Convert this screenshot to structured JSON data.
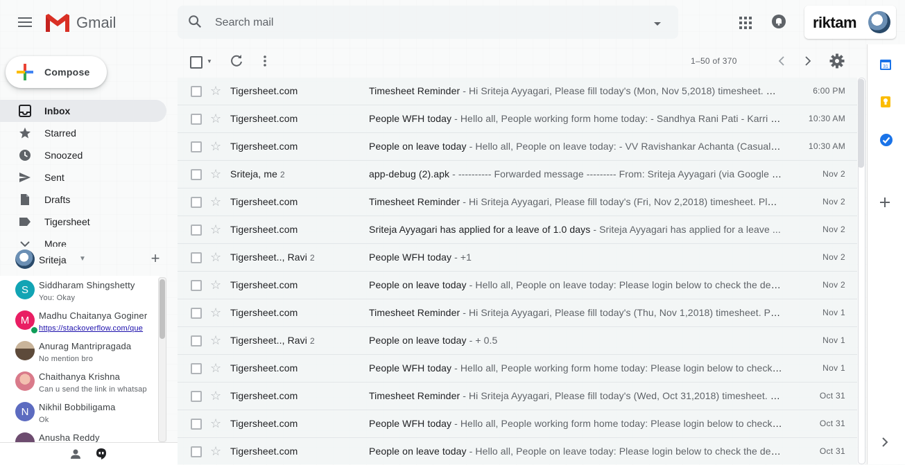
{
  "header": {
    "logo_text": "Gmail",
    "search_placeholder": "Search mail",
    "org_name": "riktam"
  },
  "sidebar": {
    "compose_label": "Compose",
    "items": [
      {
        "label": "Inbox",
        "icon": "inbox-icon",
        "active": true
      },
      {
        "label": "Starred",
        "icon": "star-icon"
      },
      {
        "label": "Snoozed",
        "icon": "clock-icon"
      },
      {
        "label": "Sent",
        "icon": "send-icon"
      },
      {
        "label": "Drafts",
        "icon": "draft-icon"
      },
      {
        "label": "Tigersheet",
        "icon": "label-icon"
      },
      {
        "label": "More",
        "icon": "chevron-down-icon"
      }
    ]
  },
  "hangouts": {
    "user_name": "Sriteja",
    "contacts": [
      {
        "name": "Siddharam Shingshetty",
        "message": "You: Okay",
        "initial": "S",
        "color": "#12a4b4",
        "link": false,
        "online": false
      },
      {
        "name": "Madhu Chaitanya Goginer",
        "message": "https://stackoverflow.com/que",
        "initial": "M",
        "color": "#e91e63",
        "link": true,
        "online": true
      },
      {
        "name": "Anurag Mantripragada",
        "message": "No mention bro",
        "initial": "",
        "color": "#5d4a3a",
        "link": false,
        "online": false
      },
      {
        "name": "Chaithanya Krishna",
        "message": "Can u send the link in whatsap",
        "initial": "",
        "color": "#d97a8a",
        "link": false,
        "online": false
      },
      {
        "name": "Nikhil Bobbiligama",
        "message": "Ok",
        "initial": "N",
        "color": "#5c6bc0",
        "link": false,
        "online": false
      },
      {
        "name": "Anusha Reddy",
        "message": "",
        "initial": "",
        "color": "#6d4c6f",
        "link": false,
        "online": false
      }
    ]
  },
  "toolbar": {
    "pagination": "1–50 of 370"
  },
  "emails": [
    {
      "sender": "Tigersheet.com",
      "count": "",
      "subject": "Timesheet Reminder",
      "snippet": " - Hi Sriteja Ayyagari, Please fill today's (Mon, Nov 5,2018) timesheet. Pl...",
      "date": "6:00 PM"
    },
    {
      "sender": "Tigersheet.com",
      "count": "",
      "subject": "People WFH today",
      "snippet": " - Hello all, People working form home today: - Sandhya Rani Pati - Karri S...",
      "date": "10:30 AM"
    },
    {
      "sender": "Tigersheet.com",
      "count": "",
      "subject": "People on leave today",
      "snippet": " - Hello all, People on leave today: - VV Ravishankar Achanta (Casual) -...",
      "date": "10:30 AM"
    },
    {
      "sender": "Sriteja, me",
      "count": "2",
      "subject": "app-debug (2).apk",
      "snippet": " - ---------- Forwarded message --------- From: Sriteja Ayyagari (via Google Dr...",
      "date": "Nov 2"
    },
    {
      "sender": "Tigersheet.com",
      "count": "",
      "subject": "Timesheet Reminder",
      "snippet": " - Hi Sriteja Ayyagari, Please fill today's (Fri, Nov 2,2018) timesheet. Plea...",
      "date": "Nov 2"
    },
    {
      "sender": "Tigersheet.com",
      "count": "",
      "subject": "Sriteja Ayyagari has applied for a leave of 1.0 days",
      "snippet": " - Sriteja Ayyagari has applied for a leave ...",
      "date": "Nov 2"
    },
    {
      "sender": "Tigersheet.., Ravi",
      "count": "2",
      "subject": "People WFH today",
      "snippet": " - +1",
      "date": "Nov 2"
    },
    {
      "sender": "Tigersheet.com",
      "count": "",
      "subject": "People on leave today",
      "snippet": " - Hello all, People on leave today: Please login below to check the deta...",
      "date": "Nov 2"
    },
    {
      "sender": "Tigersheet.com",
      "count": "",
      "subject": "Timesheet Reminder",
      "snippet": " - Hi Sriteja Ayyagari, Please fill today's (Thu, Nov 1,2018) timesheet. Ple...",
      "date": "Nov 1"
    },
    {
      "sender": "Tigersheet.., Ravi",
      "count": "2",
      "subject": "People on leave today",
      "snippet": " - + 0.5",
      "date": "Nov 1"
    },
    {
      "sender": "Tigersheet.com",
      "count": "",
      "subject": "People WFH today",
      "snippet": " - Hello all, People working form home today: Please login below to check ...",
      "date": "Nov 1"
    },
    {
      "sender": "Tigersheet.com",
      "count": "",
      "subject": "Timesheet Reminder",
      "snippet": " - Hi Sriteja Ayyagari, Please fill today's (Wed, Oct 31,2018) timesheet. Pl...",
      "date": "Oct 31"
    },
    {
      "sender": "Tigersheet.com",
      "count": "",
      "subject": "People WFH today",
      "snippet": " - Hello all, People working form home today: Please login below to check ...",
      "date": "Oct 31"
    },
    {
      "sender": "Tigersheet.com",
      "count": "",
      "subject": "People on leave today",
      "snippet": " - Hello all, People on leave today: Please login below to check the deta...",
      "date": "Oct 31"
    }
  ],
  "side_panel": {
    "calendar_day": "31"
  },
  "colors": {
    "gmail_red": "#d93025",
    "inbox_active_bg": "#e8eaed",
    "online_green": "#0f9d58"
  }
}
